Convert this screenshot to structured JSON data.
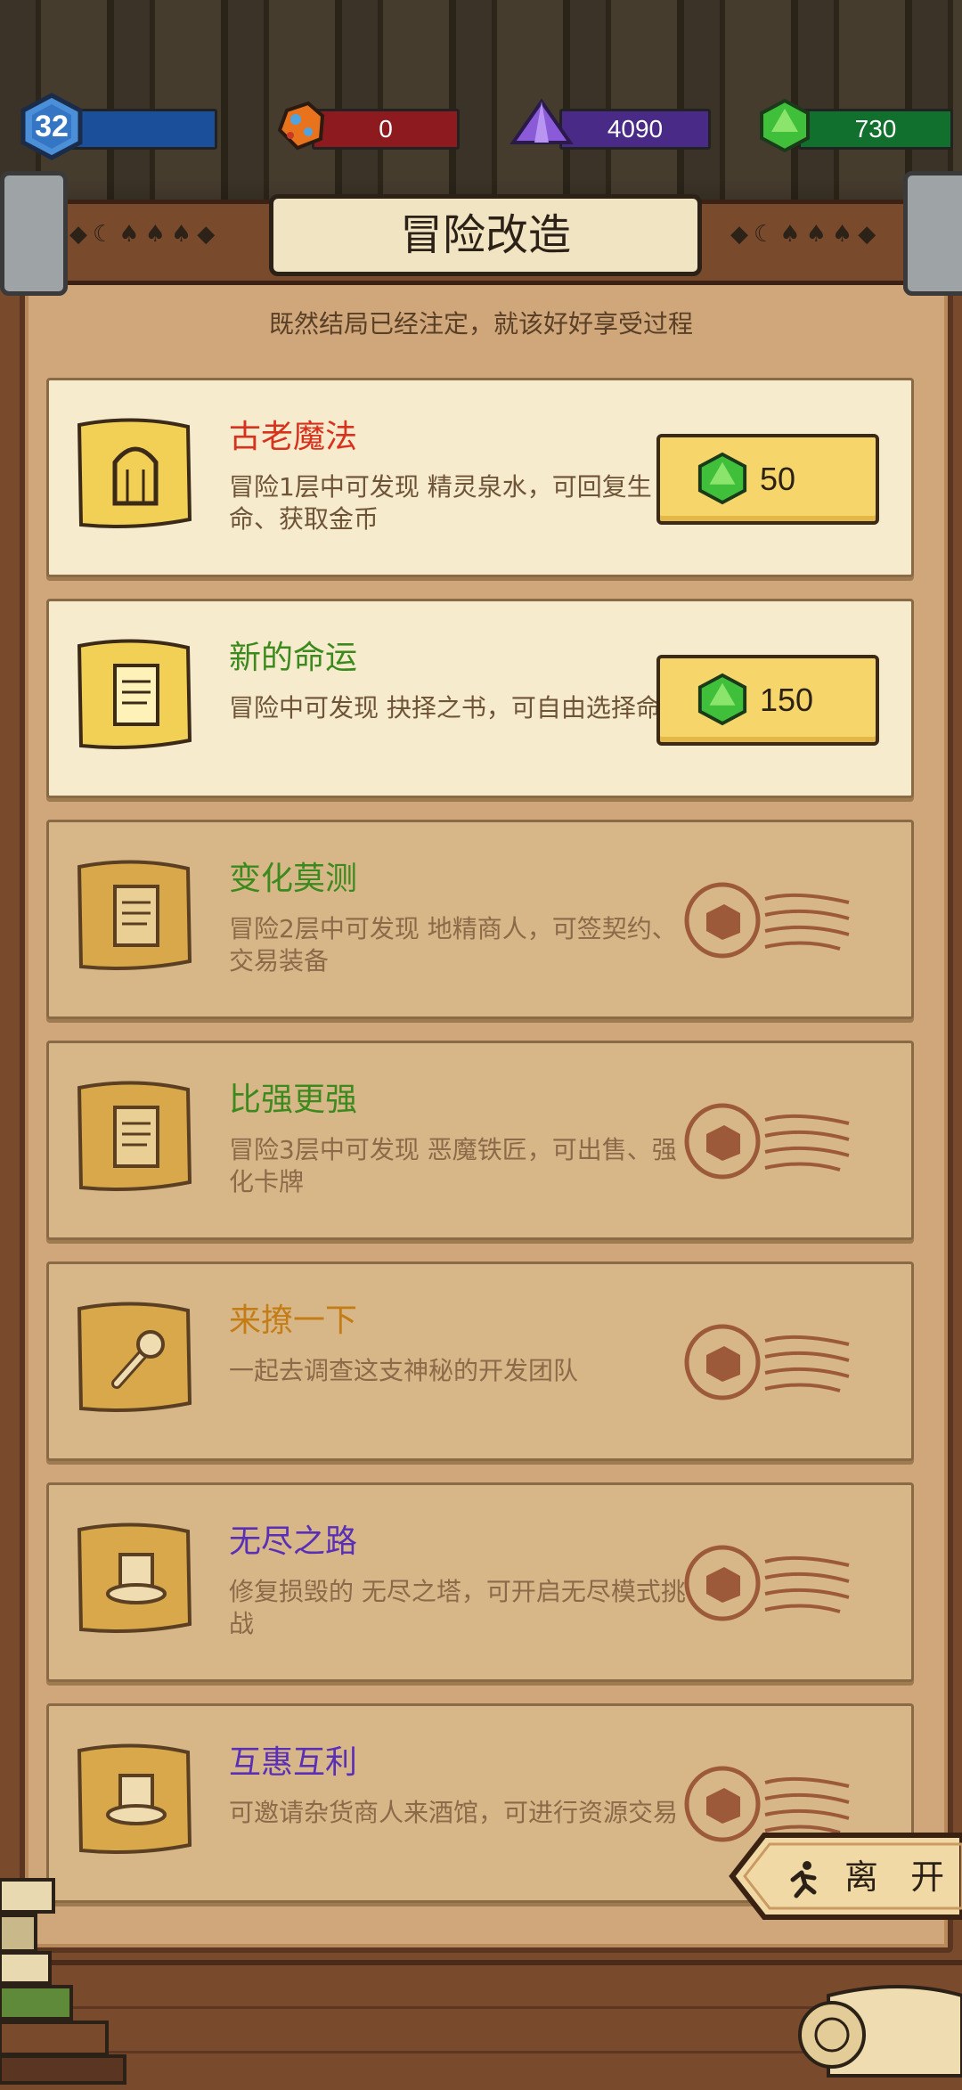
{
  "status_bar": {
    "level": "32",
    "ruby": "0",
    "crystal": "4090",
    "emerald": "730",
    "colors": {
      "level_bar": "#1c4f9a",
      "ruby_bar": "#8c1a1e",
      "crystal_bar": "#4a2a87",
      "emerald_bar": "#12702e"
    }
  },
  "header": {
    "title": "冒险改造",
    "subtitle": "既然结局已经注定，就该好好享受过程"
  },
  "upgrades": [
    {
      "name": "古老魔法",
      "name_color": "#d8321f",
      "desc": "冒险1层中可发现 精灵泉水，可回复生命、获取金币",
      "state": "available",
      "price": "50",
      "icon": "fountain-icon"
    },
    {
      "name": "新的命运",
      "name_color": "#3c8a1e",
      "desc": "冒险中可发现 抉择之书，可自由选择命运",
      "state": "available",
      "price": "150",
      "icon": "book-icon"
    },
    {
      "name": "变化莫测",
      "name_color": "#3c8a1e",
      "desc": "冒险2层中可发现 地精商人，可签契约、交易装备",
      "state": "locked",
      "icon": "book-icon"
    },
    {
      "name": "比强更强",
      "name_color": "#3c8a1e",
      "desc": "冒险3层中可发现 恶魔铁匠，可出售、强化卡牌",
      "state": "locked",
      "icon": "book-icon"
    },
    {
      "name": "来撩一下",
      "name_color": "#c47c16",
      "desc": "一起去调查这支神秘的开发团队",
      "state": "locked",
      "icon": "wrench-icon"
    },
    {
      "name": "无尽之路",
      "name_color": "#5a2fb8",
      "desc": "修复损毁的 无尽之塔，可开启无尽模式挑战",
      "state": "locked",
      "icon": "hat-icon"
    },
    {
      "name": "互惠互利",
      "name_color": "#5a2fb8",
      "desc": "可邀请杂货商人来酒馆，可进行资源交易",
      "state": "locked",
      "icon": "hat-icon"
    }
  ],
  "leave_button": {
    "label": "离 开",
    "icon": "running-man-icon"
  }
}
